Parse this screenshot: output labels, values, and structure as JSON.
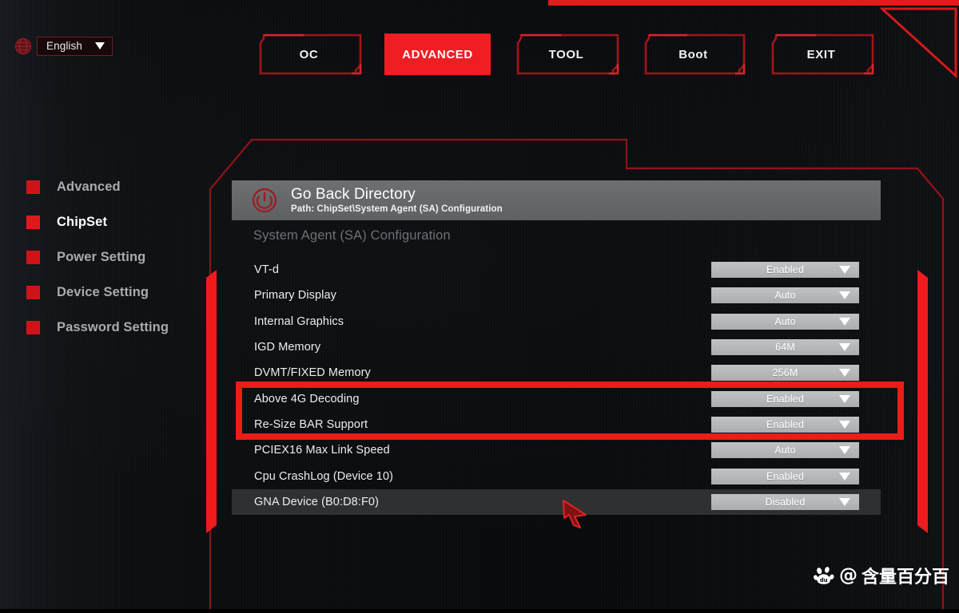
{
  "language": {
    "icon": "globe-icon",
    "value": "English",
    "caret": "chevron-down-icon"
  },
  "tabs": [
    {
      "label": "OC",
      "active": false
    },
    {
      "label": "ADVANCED",
      "active": true
    },
    {
      "label": "TOOL",
      "active": false
    },
    {
      "label": "Boot",
      "active": false
    },
    {
      "label": "EXIT",
      "active": false
    }
  ],
  "sidebar": {
    "items": [
      {
        "label": "Advanced",
        "selected": false
      },
      {
        "label": "ChipSet",
        "selected": true
      },
      {
        "label": "Power Setting",
        "selected": false
      },
      {
        "label": "Device Setting",
        "selected": false
      },
      {
        "label": "Password Setting",
        "selected": false
      }
    ]
  },
  "directory": {
    "icon": "power-back-icon",
    "title": "Go Back Directory",
    "path": "Path: ChipSet\\System Agent (SA) Configuration"
  },
  "main": {
    "section_title": "System Agent (SA) Configuration",
    "settings": [
      {
        "name": "VT-d",
        "value": "Enabled",
        "highlighted": false,
        "annotated": false
      },
      {
        "name": "Primary Display",
        "value": "Auto",
        "highlighted": false,
        "annotated": false
      },
      {
        "name": "Internal Graphics",
        "value": "Auto",
        "highlighted": false,
        "annotated": false
      },
      {
        "name": "IGD Memory",
        "value": "64M",
        "highlighted": false,
        "annotated": false
      },
      {
        "name": "DVMT/FIXED Memory",
        "value": "256M",
        "highlighted": false,
        "annotated": false
      },
      {
        "name": "Above 4G Decoding",
        "value": "Enabled",
        "highlighted": false,
        "annotated": true
      },
      {
        "name": "Re-Size BAR Support",
        "value": "Enabled",
        "highlighted": false,
        "annotated": true
      },
      {
        "name": "PCIEX16 Max Link Speed",
        "value": "Auto",
        "highlighted": false,
        "annotated": false
      },
      {
        "name": "Cpu CrashLog (Device 10)",
        "value": "Enabled",
        "highlighted": false,
        "annotated": false
      },
      {
        "name": "GNA Device (B0:D8:F0)",
        "value": "Disabled",
        "highlighted": true,
        "annotated": false
      }
    ]
  },
  "annotation": {
    "type": "red-highlight-box",
    "color": "#ec1c16",
    "targets": [
      "Above 4G Decoding",
      "Re-Size BAR Support"
    ]
  },
  "cursor": {
    "icon": "arrow-cursor-icon",
    "color": "#d41f1f"
  },
  "watermark": {
    "icon": "baidu-paw-icon",
    "at": "@",
    "text": "含量百分百"
  },
  "colors": {
    "accent_red": "#ee1c1c",
    "tab_active": "#f01e22",
    "frame_red": "#8e1418",
    "dropdown": "#b6b8ba",
    "header_gray": "#66686a"
  }
}
